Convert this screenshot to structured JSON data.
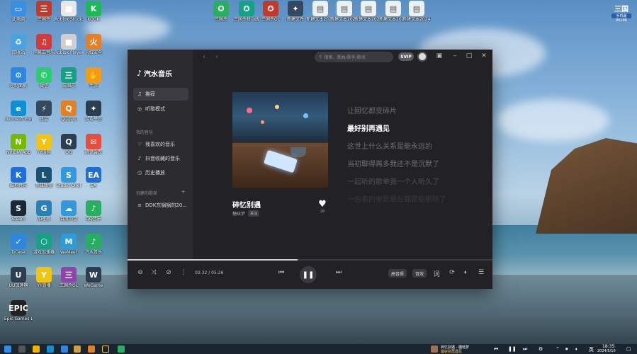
{
  "desktop": {
    "brand": {
      "title": "三国",
      "badge": "手机版",
      "number": "95186"
    },
    "icons_left": [
      {
        "label": "此电脑",
        "color": "#3b8fe0",
        "glyph": "▭"
      },
      {
        "label": "三国杀",
        "color": "#c0392b",
        "glyph": "三"
      },
      {
        "label": "Roblox Studio",
        "color": "#e8e8e8",
        "glyph": "■"
      },
      {
        "label": "KOOK",
        "color": "#1db954",
        "glyph": "K"
      },
      {
        "label": "回收站",
        "color": "#4aa3df",
        "glyph": "♻"
      },
      {
        "label": "网易云音乐",
        "color": "#d33b3b",
        "glyph": "♫"
      },
      {
        "label": "Roblox Player",
        "color": "#cfcfcf",
        "glyph": "■"
      },
      {
        "label": "火绒安全",
        "color": "#e67e22",
        "glyph": "火"
      },
      {
        "label": "控制面板",
        "color": "#2e86de",
        "glyph": "⚙"
      },
      {
        "label": "微信",
        "color": "#2ecc71",
        "glyph": "✆"
      },
      {
        "label": "三国志",
        "color": "#16a085",
        "glyph": "三"
      },
      {
        "label": "手游",
        "color": "#f39c12",
        "glyph": "✋"
      },
      {
        "label": "Microsoft Edge",
        "color": "#0f8fd4",
        "glyph": "e"
      },
      {
        "label": "迅雷",
        "color": "#34495e",
        "glyph": "⚡"
      },
      {
        "label": "QQ游戏",
        "color": "#e67e22",
        "glyph": "Q"
      },
      {
        "label": "游戏平台",
        "color": "#2c3e50",
        "glyph": "✦"
      },
      {
        "label": "NVIDIA App",
        "color": "#76b900",
        "glyph": "N"
      },
      {
        "label": "YY语音",
        "color": "#f1c40f",
        "glyph": "Y"
      },
      {
        "label": "QQ",
        "color": "#2c3e50",
        "glyph": "Q"
      },
      {
        "label": "腾讯会议",
        "color": "#e74c3c",
        "glyph": "✉"
      },
      {
        "label": "酷狗音乐",
        "color": "#1e6fd9",
        "glyph": "K"
      },
      {
        "label": "英雄联盟",
        "color": "#1a5276",
        "glyph": "L"
      },
      {
        "label": "Studio Onef",
        "color": "#3498db",
        "glyph": "S"
      },
      {
        "label": "EA",
        "color": "#1f6fd1",
        "glyph": "EA"
      },
      {
        "label": "Steam",
        "color": "#1b2838",
        "glyph": "S"
      },
      {
        "label": "加速器",
        "color": "#2980b9",
        "glyph": "G"
      },
      {
        "label": "百度网盘",
        "color": "#3498db",
        "glyph": "☁"
      },
      {
        "label": "QQ音乐",
        "color": "#27ae60",
        "glyph": "♪"
      },
      {
        "label": "ToDesk",
        "color": "#2e86de",
        "glyph": "✓"
      },
      {
        "label": "游戏加速器",
        "color": "#16a085",
        "glyph": "⬡"
      },
      {
        "label": "WeMeet",
        "color": "#2d9cdb",
        "glyph": "M"
      },
      {
        "label": "汽水音乐",
        "color": "#27ae60",
        "glyph": "♪"
      },
      {
        "label": "UU加速器",
        "color": "#2c3e50",
        "glyph": "U"
      },
      {
        "label": "YY直播",
        "color": "#f1c40f",
        "glyph": "Y"
      },
      {
        "label": "三国杀OL",
        "color": "#8e44ad",
        "glyph": "三"
      },
      {
        "label": "WeGame",
        "color": "#2c3e50",
        "glyph": "W"
      },
      {
        "label": "Epic Games Launcher",
        "color": "#222",
        "glyph": "EPIC"
      }
    ],
    "icons_top": [
      {
        "label": "三国杀",
        "color": "#27ae60",
        "glyph": "✪"
      },
      {
        "label": "三国杀移动版",
        "color": "#16a085",
        "glyph": "✪"
      },
      {
        "label": "三国杀OL",
        "color": "#c0392b",
        "glyph": "✪"
      },
      {
        "label": "新建文件",
        "color": "#34495e",
        "glyph": "✦"
      },
      {
        "label": "新建文本2024",
        "color": "#ecf0f1",
        "glyph": "▤"
      },
      {
        "label": "新建文本20241",
        "color": "#ecf0f1",
        "glyph": "▤"
      },
      {
        "label": "新建文本20242",
        "color": "#ecf0f1",
        "glyph": "▤"
      },
      {
        "label": "新建文本20243",
        "color": "#ecf0f1",
        "glyph": "▤"
      },
      {
        "label": "新建文本20244",
        "color": "#ecf0f1",
        "glyph": "▤"
      }
    ]
  },
  "app": {
    "name": "汽水音乐",
    "nav": {
      "recommend": "推荐",
      "listen_mode": "听歌模式",
      "my_music_header": "我的音乐",
      "liked": "我喜欢的音乐",
      "douyin_fav": "抖音收藏的音乐",
      "history": "历史播放",
      "created_header": "创建的歌单",
      "playlist_1": "DDK东锅锅的20..."
    },
    "search": {
      "placeholder": "搜索，歌曲/歌手/歌词"
    },
    "svip": "SVIP",
    "song": {
      "title": "碎忆别遇",
      "artist": "糖晗梦",
      "follow": "关注",
      "likes": "28"
    },
    "lyrics": [
      {
        "text": "让回忆都变碎片",
        "current": false
      },
      {
        "text": "最好别再遇见",
        "current": true
      },
      {
        "text": "这世上什么关系是能永远的",
        "current": false
      },
      {
        "text": "当初聊得再多我还不是沉默了",
        "current": false
      },
      {
        "text": "一起听的歌单我一个人听久了",
        "current": false
      },
      {
        "text": "一后看的电影最后都是能删除了",
        "current": false
      }
    ],
    "player": {
      "time": "02:32 / 05:26",
      "quality": "高音质",
      "sound": "音效",
      "progress": 0.466
    }
  },
  "taskbar": {
    "now_playing_line1": "碎忆别遇 - 糖晗梦",
    "now_playing_line2": "最好别再遇见",
    "input_lang": "英",
    "clock_time": "18:35",
    "clock_date": "2024/5/10"
  }
}
